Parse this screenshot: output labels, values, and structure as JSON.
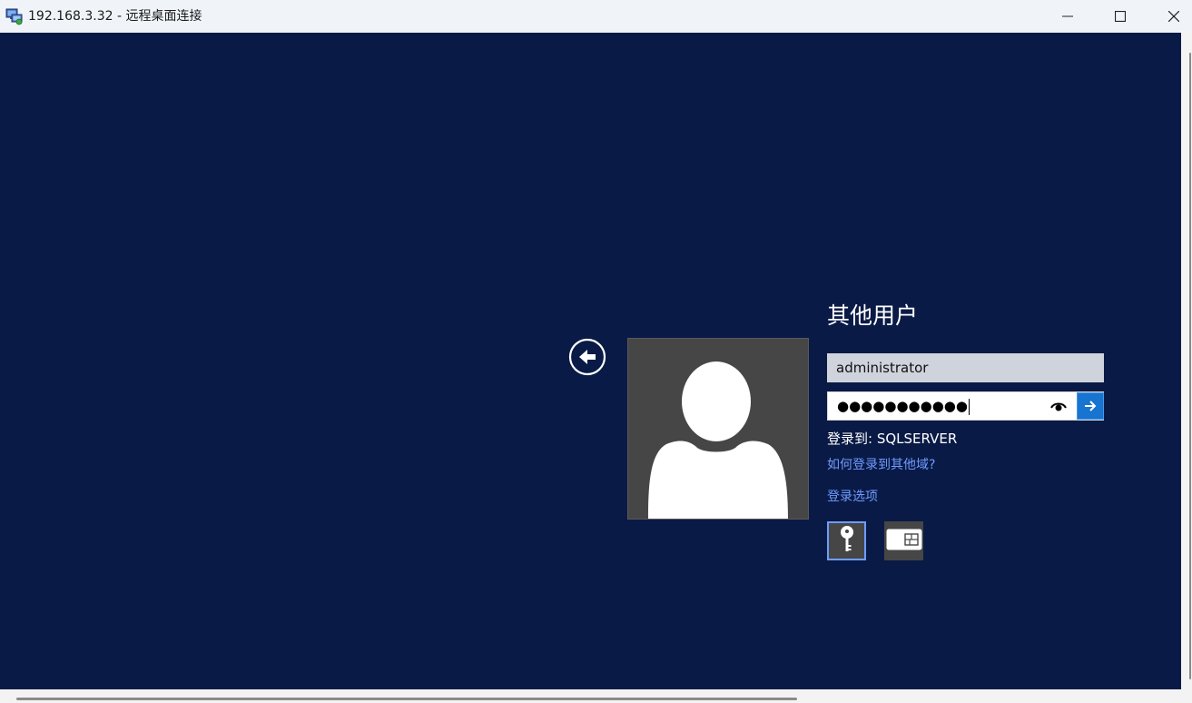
{
  "window": {
    "title": "192.168.3.32 - 远程桌面连接",
    "icon": "remote-desktop-icon",
    "controls": [
      "minimize-icon",
      "maximize-icon",
      "close-icon"
    ]
  },
  "login": {
    "user_title": "其他用户",
    "username_value": "administrator",
    "password_mask": "●●●●●●●●●●●",
    "sign_in_to": "登录到: SQLSERVER",
    "domain_link": "如何登录到其他域?",
    "options_link": "登录选项",
    "options": [
      {
        "name": "password-option",
        "icon": "key-icon",
        "selected": true
      },
      {
        "name": "smartcard-option",
        "icon": "smart-card-icon",
        "selected": false
      }
    ]
  },
  "colors": {
    "background": "#0a1a46",
    "link": "#6f9cff",
    "submit": "#1774d0",
    "tile": "#464646"
  }
}
